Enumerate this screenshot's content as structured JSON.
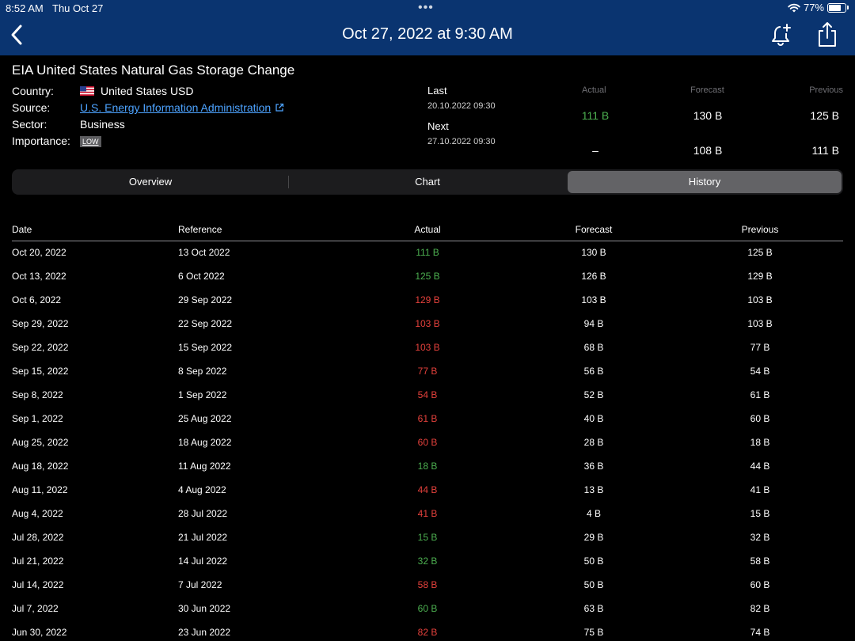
{
  "status_bar": {
    "time": "8:52 AM",
    "date": "Thu Oct 27",
    "battery_percent": "77%",
    "battery_level": 0.77
  },
  "nav": {
    "title": "Oct 27, 2022 at 9:30 AM"
  },
  "event": {
    "title": "EIA United States Natural Gas Storage Change",
    "country_label": "Country:",
    "country_value": "United States USD",
    "source_label": "Source:",
    "source_value": "U.S. Energy Information Administration",
    "sector_label": "Sector:",
    "sector_value": "Business",
    "importance_label": "Importance:",
    "importance_value": "LOW",
    "last_label": "Last",
    "last_date": "20.10.2022 09:30",
    "next_label": "Next",
    "next_date": "27.10.2022 09:30",
    "headers": {
      "actual": "Actual",
      "forecast": "Forecast",
      "previous": "Previous"
    },
    "last_values": {
      "actual": "111 B",
      "forecast": "130 B",
      "previous": "125 B"
    },
    "next_values": {
      "actual": "–",
      "forecast": "108 B",
      "previous": "111 B"
    }
  },
  "tabs": [
    {
      "label": "Overview",
      "active": false
    },
    {
      "label": "Chart",
      "active": false
    },
    {
      "label": "History",
      "active": true
    }
  ],
  "history": {
    "columns": {
      "date": "Date",
      "reference": "Reference",
      "actual": "Actual",
      "forecast": "Forecast",
      "previous": "Previous"
    },
    "rows": [
      {
        "date": "Oct 20, 2022",
        "reference": "13 Oct 2022",
        "actual": "111 B",
        "trend": "up",
        "forecast": "130 B",
        "previous": "125 B"
      },
      {
        "date": "Oct 13, 2022",
        "reference": "6 Oct 2022",
        "actual": "125 B",
        "trend": "up",
        "forecast": "126 B",
        "previous": "129 B"
      },
      {
        "date": "Oct 6, 2022",
        "reference": "29 Sep 2022",
        "actual": "129 B",
        "trend": "down",
        "forecast": "103 B",
        "previous": "103 B"
      },
      {
        "date": "Sep 29, 2022",
        "reference": "22 Sep 2022",
        "actual": "103 B",
        "trend": "down",
        "forecast": "94 B",
        "previous": "103 B"
      },
      {
        "date": "Sep 22, 2022",
        "reference": "15 Sep 2022",
        "actual": "103 B",
        "trend": "down",
        "forecast": "68 B",
        "previous": "77 B"
      },
      {
        "date": "Sep 15, 2022",
        "reference": "8 Sep 2022",
        "actual": "77 B",
        "trend": "down",
        "forecast": "56 B",
        "previous": "54 B"
      },
      {
        "date": "Sep 8, 2022",
        "reference": "1 Sep 2022",
        "actual": "54 B",
        "trend": "down",
        "forecast": "52 B",
        "previous": "61 B"
      },
      {
        "date": "Sep 1, 2022",
        "reference": "25 Aug 2022",
        "actual": "61 B",
        "trend": "down",
        "forecast": "40 B",
        "previous": "60 B"
      },
      {
        "date": "Aug 25, 2022",
        "reference": "18 Aug 2022",
        "actual": "60 B",
        "trend": "down",
        "forecast": "28 B",
        "previous": "18 B"
      },
      {
        "date": "Aug 18, 2022",
        "reference": "11 Aug 2022",
        "actual": "18 B",
        "trend": "up",
        "forecast": "36 B",
        "previous": "44 B"
      },
      {
        "date": "Aug 11, 2022",
        "reference": "4 Aug 2022",
        "actual": "44 B",
        "trend": "down",
        "forecast": "13 B",
        "previous": "41 B"
      },
      {
        "date": "Aug 4, 2022",
        "reference": "28 Jul 2022",
        "actual": "41 B",
        "trend": "down",
        "forecast": "4 B",
        "previous": "15 B"
      },
      {
        "date": "Jul 28, 2022",
        "reference": "21 Jul 2022",
        "actual": "15 B",
        "trend": "up",
        "forecast": "29 B",
        "previous": "32 B"
      },
      {
        "date": "Jul 21, 2022",
        "reference": "14 Jul 2022",
        "actual": "32 B",
        "trend": "up",
        "forecast": "50 B",
        "previous": "58 B"
      },
      {
        "date": "Jul 14, 2022",
        "reference": "7 Jul 2022",
        "actual": "58 B",
        "trend": "down",
        "forecast": "50 B",
        "previous": "60 B"
      },
      {
        "date": "Jul 7, 2022",
        "reference": "30 Jun 2022",
        "actual": "60 B",
        "trend": "up",
        "forecast": "63 B",
        "previous": "82 B"
      },
      {
        "date": "Jun 30, 2022",
        "reference": "23 Jun 2022",
        "actual": "82 B",
        "trend": "down",
        "forecast": "75 B",
        "previous": "74 B"
      }
    ]
  },
  "colors": {
    "nav_background": "#0a3470",
    "actual_up": "#4caf50",
    "actual_down": "#e5413c",
    "link": "#4da3ff"
  },
  "icons": [
    "chevron-left-icon",
    "alarm-bell-plus-icon",
    "share-icon",
    "wifi-icon",
    "battery-icon",
    "us-flag-icon",
    "external-link-icon"
  ]
}
